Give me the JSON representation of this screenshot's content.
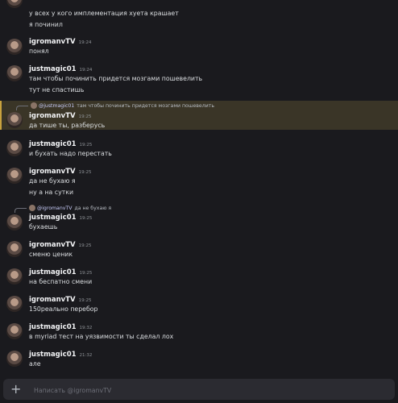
{
  "topbar": {
    "left_text": "—",
    "right_text": ""
  },
  "messages": [
    {
      "lines": [
        "у всех у кого имплементация хуета крашает",
        "я починил"
      ]
    },
    {
      "author": "igromanvTV",
      "time": "19:24",
      "lines": [
        "понял"
      ]
    },
    {
      "author": "justmagic01",
      "time": "19:24",
      "lines": [
        "там чтобы починить придется мозгами пошевелить",
        "тут не спастишь"
      ]
    },
    {
      "reply_to": "@justmagic01",
      "reply_text": "там чтобы починить придется мозгами пошевелить",
      "author": "igromanvTV",
      "time": "19:25",
      "lines": [
        "да тише ты, разберусь"
      ]
    },
    {
      "author": "justmagic01",
      "time": "19:25",
      "lines": [
        "и бухать надо перестать"
      ]
    },
    {
      "author": "igromanvTV",
      "time": "19:25",
      "lines": [
        "да не бухаю я",
        "ну а на сутки"
      ]
    },
    {
      "reply_to": "@igromanvTV",
      "reply_text": "да не бухаю я",
      "author": "justmagic01",
      "time": "19:25",
      "lines": [
        "бухаешь"
      ]
    },
    {
      "author": "igromanvTV",
      "time": "19:25",
      "lines": [
        "сменю ценик"
      ]
    },
    {
      "author": "justmagic01",
      "time": "19:25",
      "lines": [
        "на беспатно смени"
      ]
    },
    {
      "author": "igromanvTV",
      "time": "19:25",
      "lines": [
        "150реально перебор"
      ]
    },
    {
      "author": "justmagic01",
      "time": "19:32",
      "lines": [
        "в myriad тест на уязвимости ты сделал лох"
      ]
    },
    {
      "author": "justmagic01",
      "time": "21:32",
      "lines": [
        "але"
      ]
    }
  ],
  "composer": {
    "plus_icon": "+",
    "placeholder": "Написать @igromanvTV"
  },
  "colors": {
    "background": "#1a1a1e",
    "highlight": "#3a3527",
    "composer": "#2b2b31"
  }
}
